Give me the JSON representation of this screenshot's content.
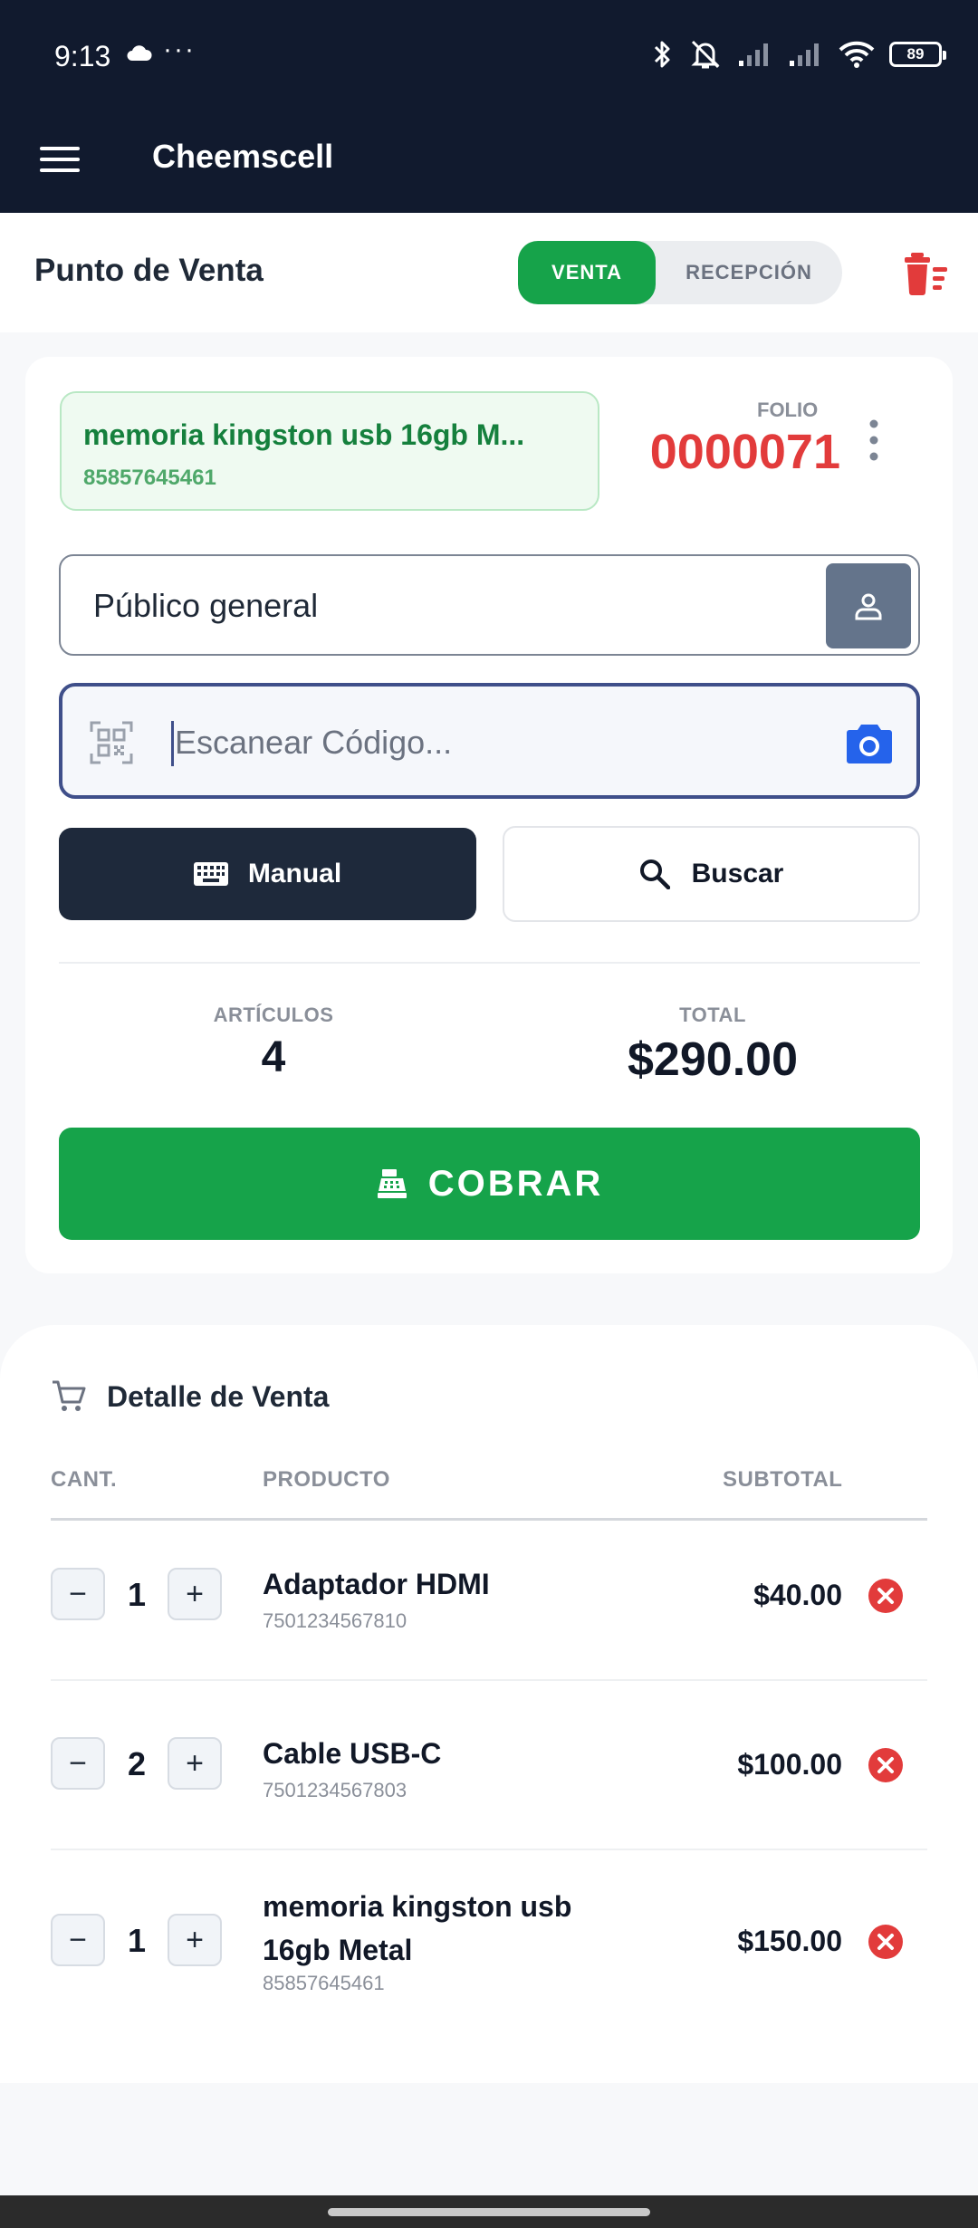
{
  "status_bar": {
    "time": "9:13",
    "more": "···",
    "battery": "89"
  },
  "app_bar": {
    "title": "Cheemscell"
  },
  "header": {
    "title": "Punto de Venta",
    "tab_venta": "VENTA",
    "tab_recepcion": "RECEPCIÓN"
  },
  "last_item": {
    "name": "memoria kingston usb 16gb M...",
    "code": "85857645461"
  },
  "folio": {
    "label": "FOLIO",
    "value": "0000071"
  },
  "client": {
    "name": "Público general"
  },
  "scan": {
    "placeholder": "Escanear Código..."
  },
  "buttons": {
    "manual": "Manual",
    "buscar": "Buscar",
    "cobrar": "COBRAR"
  },
  "stats": {
    "articulos_label": "ARTÍCULOS",
    "articulos_value": "4",
    "total_label": "TOTAL",
    "total_value": "$290.00"
  },
  "detail": {
    "title": "Detalle de Venta",
    "col_cant": "CANT.",
    "col_producto": "PRODUCTO",
    "col_subtotal": "SUBTOTAL",
    "items": [
      {
        "qty": "1",
        "name": "Adaptador HDMI",
        "code": "7501234567810",
        "subtotal": "$40.00"
      },
      {
        "qty": "2",
        "name": "Cable USB-C",
        "code": "7501234567803",
        "subtotal": "$100.00"
      },
      {
        "qty": "1",
        "name": "memoria kingston usb 16gb Metal",
        "code": "85857645461",
        "subtotal": "$150.00"
      }
    ]
  },
  "colors": {
    "navy": "#111a2e",
    "green": "#16a34a",
    "red": "#e23b3b",
    "dark_button": "#1e293b"
  }
}
